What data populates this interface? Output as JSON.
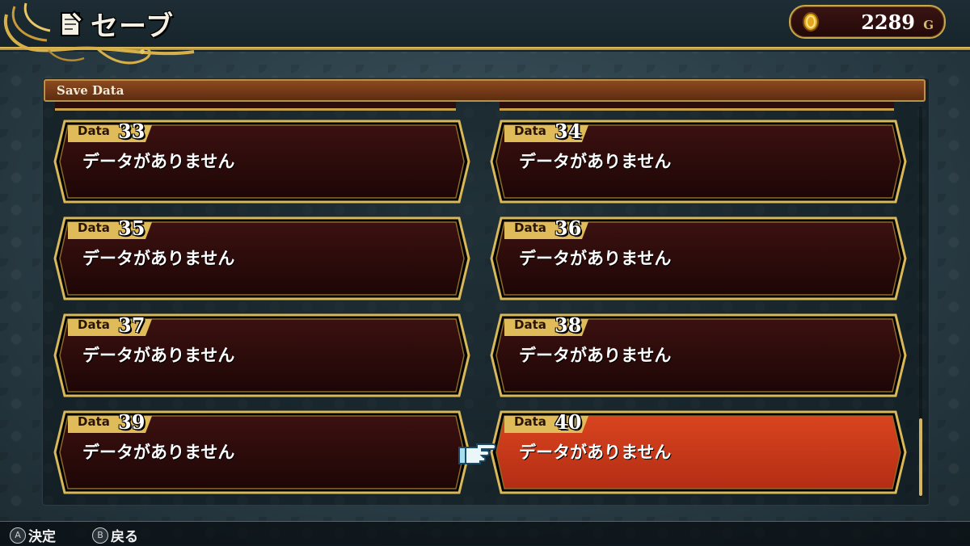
{
  "header": {
    "title": "セーブ",
    "title_icon": "document-pen-icon",
    "gold_icon": "gold-coin-icon",
    "gold_amount": "2289",
    "gold_unit": "G"
  },
  "panel": {
    "title": "Save Data"
  },
  "slots": [
    {
      "tag": "Data",
      "number": "33",
      "status": "データがありません",
      "selected": false
    },
    {
      "tag": "Data",
      "number": "34",
      "status": "データがありません",
      "selected": false
    },
    {
      "tag": "Data",
      "number": "35",
      "status": "データがありません",
      "selected": false
    },
    {
      "tag": "Data",
      "number": "36",
      "status": "データがありません",
      "selected": false
    },
    {
      "tag": "Data",
      "number": "37",
      "status": "データがありません",
      "selected": false
    },
    {
      "tag": "Data",
      "number": "38",
      "status": "データがありません",
      "selected": false
    },
    {
      "tag": "Data",
      "number": "39",
      "status": "データがありません",
      "selected": false
    },
    {
      "tag": "Data",
      "number": "40",
      "status": "データがありません",
      "selected": true
    }
  ],
  "cursor_icon": "pointing-hand-icon",
  "footer": {
    "confirm_button": "A",
    "confirm_label": "決定",
    "back_button": "B",
    "back_label": "戻る"
  },
  "colors": {
    "slot_bg": "#2a0b0b",
    "slot_selected_bg": "#c8391a",
    "gold_border": "#d9b85a",
    "tab_gold": "#e0bb5a"
  }
}
